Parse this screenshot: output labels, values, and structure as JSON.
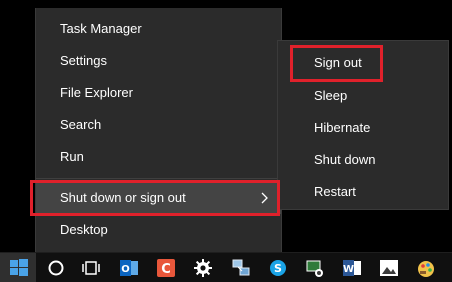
{
  "start_menu": {
    "items": [
      {
        "label": "Task Manager"
      },
      {
        "label": "Settings"
      },
      {
        "label": "File Explorer"
      },
      {
        "label": "Search"
      },
      {
        "label": "Run"
      },
      {
        "label": "Shut down or sign out",
        "has_submenu": true,
        "active": true
      },
      {
        "label": "Desktop"
      }
    ]
  },
  "submenu": {
    "items": [
      {
        "label": "Sign out"
      },
      {
        "label": "Sleep"
      },
      {
        "label": "Hibernate"
      },
      {
        "label": "Shut down"
      },
      {
        "label": "Restart"
      }
    ]
  },
  "highlight_color": "#e0212b",
  "taskbar": {
    "icons": [
      "windows-start-icon",
      "cortana-icon",
      "task-view-icon",
      "outlook-icon",
      "app-c-icon",
      "settings-gear-icon",
      "network-icon",
      "skype-icon",
      "screenshot-tool-icon",
      "word-icon",
      "photos-icon",
      "paint-icon"
    ]
  }
}
